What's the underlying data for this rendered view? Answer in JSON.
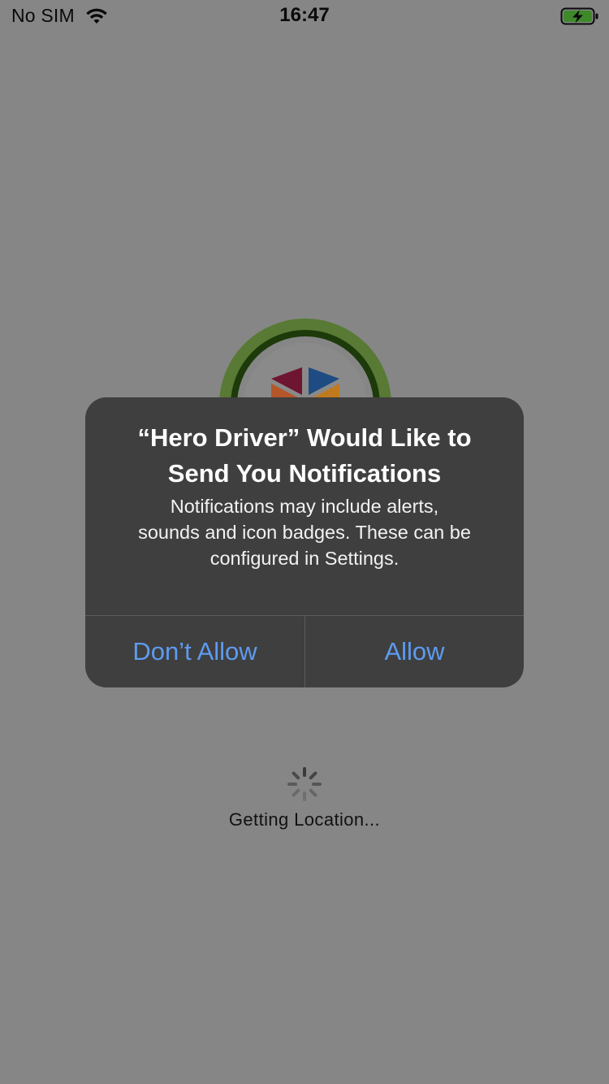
{
  "status_bar": {
    "carrier": "No SIM",
    "time": "16:47",
    "wifi_icon": "wifi-icon",
    "battery_icon": "battery-charging-icon"
  },
  "app": {
    "logo_icon": "app-logo",
    "loading_text": "Getting Location..."
  },
  "alert": {
    "title_line1": "“Hero Driver” Would Like to",
    "title_line2": "Send You Notifications",
    "message_line1": "Notifications may include alerts,",
    "message_line2": "sounds and icon badges. These can be",
    "message_line3": "configured in Settings.",
    "deny_label": "Don’t Allow",
    "allow_label": "Allow"
  },
  "colors": {
    "overlay_bg": "#868686",
    "alert_bg": "#3f3f3f",
    "button_text": "#5d9bf0",
    "logo_ring": "#3d6b1f"
  }
}
